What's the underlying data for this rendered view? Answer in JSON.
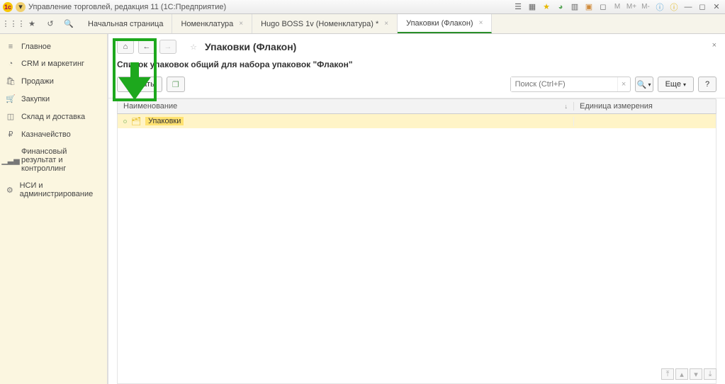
{
  "titlebar": {
    "title": "Управление торговлей, редакция 11  (1С:Предприятие)",
    "right_labels": {
      "m1": "М",
      "m2": "М+",
      "m3": "М-"
    }
  },
  "tabs": [
    {
      "label": "Начальная страница",
      "closeable": false,
      "active": false
    },
    {
      "label": "Номенклатура",
      "closeable": true,
      "active": false
    },
    {
      "label": "Hugo BOSS 1v (Номенклатура) *",
      "closeable": true,
      "active": false
    },
    {
      "label": "Упаковки (Флакон)",
      "closeable": true,
      "active": true
    }
  ],
  "sidebar": [
    {
      "icon": "home",
      "label": "Главное"
    },
    {
      "icon": "pie",
      "label": "CRM и маркетинг"
    },
    {
      "icon": "bag",
      "label": "Продажи"
    },
    {
      "icon": "cart",
      "label": "Закупки"
    },
    {
      "icon": "box",
      "label": "Склад и доставка"
    },
    {
      "icon": "money",
      "label": "Казначейство"
    },
    {
      "icon": "bars",
      "label": "Финансовый результат и контроллинг"
    },
    {
      "icon": "gear",
      "label": "НСИ и администрирование"
    }
  ],
  "page": {
    "title": "Упаковки (Флакон)",
    "subtitle": "Список упаковок общий для набора упаковок \"Флакон\""
  },
  "actions": {
    "create": "Создать",
    "search_placeholder": "Поиск (Ctrl+F)",
    "more": "Еще"
  },
  "grid": {
    "columns": {
      "name": "Наименование",
      "unit": "Единица измерения"
    },
    "rows": [
      {
        "name": "Упаковки",
        "unit": ""
      }
    ]
  }
}
